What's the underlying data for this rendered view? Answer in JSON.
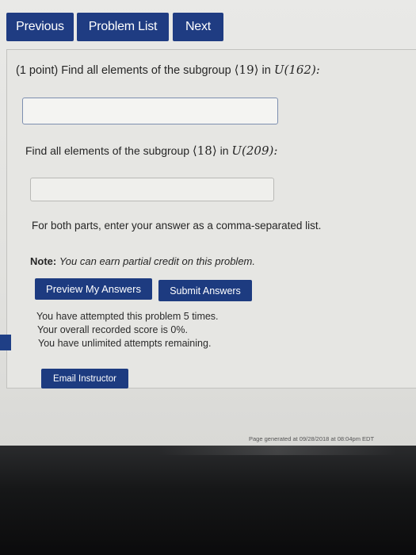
{
  "nav": {
    "previous_label": "Previous",
    "problem_list_label": "Problem List",
    "next_label": "Next"
  },
  "problem": {
    "part1": {
      "prefix": "(1 point) Find all elements of the subgroup",
      "subgroup": "⟨19⟩",
      "connector": "in",
      "group": "U(162):",
      "answer_value": ""
    },
    "part2": {
      "prefix": "Find all elements of the subgroup",
      "subgroup": "⟨18⟩",
      "connector": "in",
      "group": "U(209):",
      "answer_value": ""
    },
    "instructions": "For both parts, enter your answer as a comma-separated list.",
    "note_label": "Note:",
    "note_text": "You can earn partial credit on this problem."
  },
  "actions": {
    "preview_label": "Preview My Answers",
    "submit_label": "Submit Answers"
  },
  "attempts": {
    "line1": "You have attempted this problem 5 times.",
    "line2": "Your overall recorded score is 0%.",
    "line3": "You have unlimited attempts remaining."
  },
  "email_label": "Email Instructor",
  "footer": "Page generated at 09/28/2018 at 08:04pm EDT",
  "colors": {
    "button_blue": "#1f3c82",
    "page_bg": "#e6e6e3",
    "bezel": "#111213"
  }
}
